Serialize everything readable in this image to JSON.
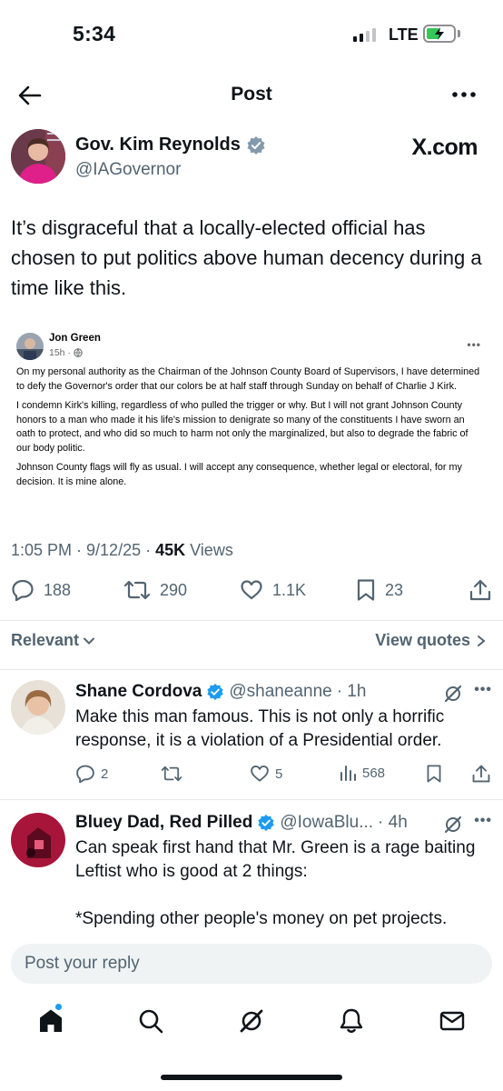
{
  "status_bar": {
    "time": "5:34",
    "network": "LTE",
    "signal_bars": 2,
    "battery_fraction": 0.5
  },
  "header": {
    "title": "Post"
  },
  "author": {
    "name": "Gov. Kim Reynolds",
    "handle": "@IAGovernor",
    "site": "X.com"
  },
  "post": {
    "text": "It’s disgraceful that a locally-elected official has chosen to put politics above human decency during a time like this.",
    "embed": {
      "name": "Jon Green",
      "time": "15h ·",
      "paragraphs": [
        "On my personal authority as the Chairman of the Johnson County Board of Supervisors, I have determined to defy the Governor's order that our colors be at half staff through Sunday on behalf of Charlie J Kirk.",
        "I condemn Kirk's killing, regardless of who pulled the trigger or why. But I will not grant Johnson County honors to a man who made it his life's mission to denigrate so many of the constituents I have sworn an oath to protect, and who did so much to harm not only the marginalized, but also to degrade the fabric of our body politic.",
        "Johnson County flags will fly as usual. I will accept any consequence, whether legal or electoral, for my decision. It is mine alone."
      ]
    },
    "meta_time": "1:05 PM · 9/12/25 · ",
    "meta_views_count": "45K",
    "meta_views_label": " Views",
    "stats": {
      "replies": "188",
      "reposts": "290",
      "likes": "1.1K",
      "bookmarks": "23"
    }
  },
  "sort": {
    "label": "Relevant",
    "view_quotes": "View quotes"
  },
  "replies": [
    {
      "name": "Shane Cordova",
      "handle": "@shaneanne",
      "time": "· 1h",
      "text": "Make this man famous. This is not only a horrific response, it is a violation of a Presidential order.",
      "replies": "2",
      "reposts": "",
      "likes": "5",
      "views": "568"
    },
    {
      "name": "Bluey Dad, Red Pilled",
      "handle": "@IowaBlu...",
      "time": "· 4h",
      "text": "Can speak first hand that Mr. Green is a rage baiting Leftist who is good at 2 things:\n\n*Spending other people's money on pet projects."
    }
  ],
  "composer": {
    "placeholder": "Post your reply"
  },
  "colors": {
    "accent": "#1d9bf0",
    "verified": "#1d9bf0",
    "text": "#0f1419",
    "secondary": "#536471"
  },
  "icons": [
    "back-arrow-icon",
    "more-icon",
    "verified-icon",
    "reply-icon",
    "repost-icon",
    "like-icon",
    "bookmark-icon",
    "share-icon",
    "views-icon",
    "grok-icon",
    "home-icon",
    "search-icon",
    "bell-icon",
    "mail-icon"
  ]
}
